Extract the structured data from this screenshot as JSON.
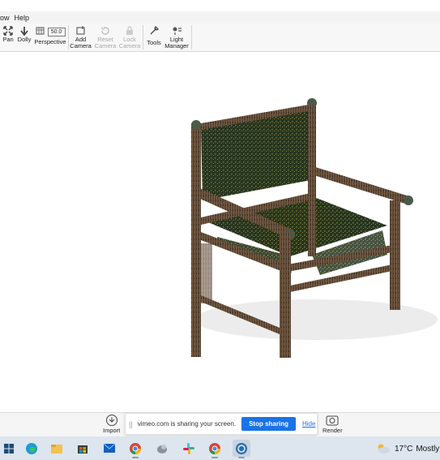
{
  "menu": [
    "ow",
    "Help"
  ],
  "toolbar": {
    "pan": "Pan",
    "dolly": "Dolly",
    "perspective": "Perspective",
    "fov_value": "50.0",
    "add_camera": [
      "Add",
      "Camera"
    ],
    "reset_camera": [
      "Reset",
      "Camera"
    ],
    "lock_camera": [
      "Lock",
      "Camera"
    ],
    "tools": "Tools",
    "light_manager": [
      "Light",
      "Manager"
    ]
  },
  "bottom": {
    "import": "Import",
    "render": "Render"
  },
  "share_banner": {
    "grip": "||",
    "message": "vimeo.com is sharing your screen.",
    "stop": "Stop sharing",
    "hide": "Hide"
  },
  "taskbar": {
    "icons": [
      "start-icon",
      "search-icon",
      "edge-icon",
      "file-explorer-icon",
      "store-icon",
      "mail-icon",
      "chrome-icon",
      "app-icon",
      "slack-icon",
      "chrome-icon",
      "keyshot-icon"
    ],
    "temperature": "17°C",
    "weather_text": "Mostly"
  },
  "colors": {
    "accent": "#1a73e8",
    "taskbar": "#dde5ee",
    "chair_wood": "#5e4a38",
    "chair_fabric": "#2c3a24"
  }
}
